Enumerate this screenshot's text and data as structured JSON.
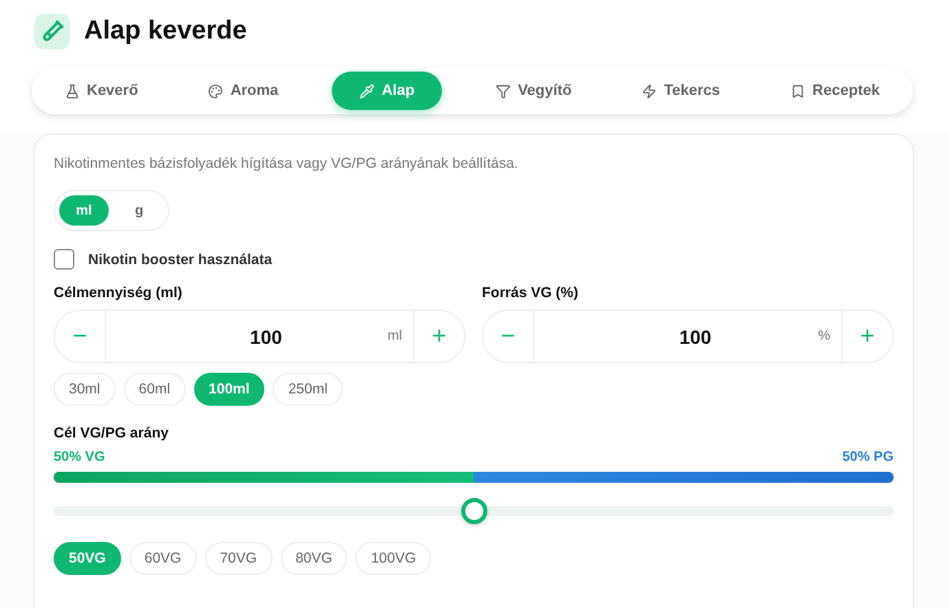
{
  "header": {
    "title": "Alap keverde"
  },
  "tabs": [
    {
      "label": "Keverő",
      "selected": false
    },
    {
      "label": "Aroma",
      "selected": false
    },
    {
      "label": "Alap",
      "selected": true
    },
    {
      "label": "Vegyítő",
      "selected": false
    },
    {
      "label": "Tekercs",
      "selected": false
    },
    {
      "label": "Receptek",
      "selected": false
    }
  ],
  "description": "Nikotinmentes bázisfolyadék hígítása vagy VG/PG arányának beállítása.",
  "units": [
    {
      "label": "ml",
      "selected": true
    },
    {
      "label": "g",
      "selected": false
    }
  ],
  "booster": {
    "label": "Nikotin booster használata",
    "checked": false
  },
  "steppers": [
    {
      "label": "Célmennyiség (ml)",
      "value": "100",
      "unit": "ml",
      "minus": "−",
      "plus": "+"
    },
    {
      "label": "Forrás VG (%)",
      "value": "100",
      "unit": "%",
      "minus": "−",
      "plus": "+"
    }
  ],
  "amount_presets": [
    {
      "label": "30ml",
      "selected": false
    },
    {
      "label": "60ml",
      "selected": false
    },
    {
      "label": "100ml",
      "selected": true
    },
    {
      "label": "250ml",
      "selected": false
    }
  ],
  "ratio": {
    "label": "Cél VG/PG arány",
    "vg_label": "50% VG",
    "pg_label": "50% PG",
    "level": 0.5
  },
  "ratio_presets": [
    {
      "label": "50VG",
      "selected": true
    },
    {
      "label": "60VG",
      "selected": false
    },
    {
      "label": "70VG",
      "selected": false
    },
    {
      "label": "80VG",
      "selected": false
    },
    {
      "label": "100VG",
      "selected": false
    }
  ]
}
